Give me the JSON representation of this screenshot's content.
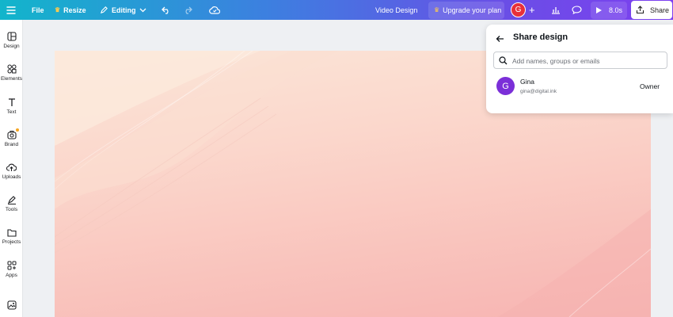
{
  "topbar": {
    "file_label": "File",
    "resize_label": "Resize",
    "editing_label": "Editing",
    "design_title": "Video Design",
    "upgrade_label": "Upgrade your plan",
    "avatar_initial": "G",
    "add_label": "+",
    "play_duration": "8.0s",
    "share_label": "Share"
  },
  "sidebar": {
    "items": [
      {
        "label": "Design",
        "icon": "design-icon"
      },
      {
        "label": "Elements",
        "icon": "elements-icon"
      },
      {
        "label": "Text",
        "icon": "text-icon"
      },
      {
        "label": "Brand",
        "icon": "brand-icon"
      },
      {
        "label": "Uploads",
        "icon": "uploads-icon"
      },
      {
        "label": "Tools",
        "icon": "tools-icon"
      },
      {
        "label": "Projects",
        "icon": "projects-icon"
      },
      {
        "label": "Apps",
        "icon": "apps-icon"
      },
      {
        "label": "",
        "icon": "photos-icon"
      }
    ]
  },
  "share_panel": {
    "title": "Share design",
    "search_placeholder": "Add names, groups or emails",
    "member": {
      "initial": "G",
      "name": "Gina",
      "email": "gina@digital.ink",
      "role": "Owner"
    }
  },
  "colors": {
    "accent": "#7d3ff0",
    "avatar_red": "#e8303a",
    "member_avatar": "#7b2fd8"
  }
}
